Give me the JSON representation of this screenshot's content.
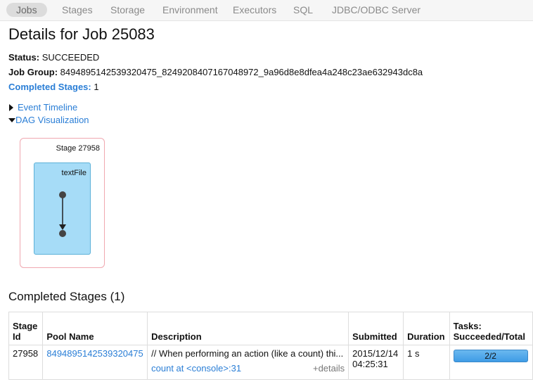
{
  "nav": {
    "items": [
      "Jobs",
      "Stages",
      "Storage",
      "Environment",
      "Executors",
      "SQL",
      "JDBC/ODBC Server"
    ],
    "active": "Jobs"
  },
  "page": {
    "title": "Details for Job 25083"
  },
  "info": {
    "status_label": "Status:",
    "status_value": "SUCCEEDED",
    "job_group_label": "Job Group:",
    "job_group_value": "8494895142539320475_8249208407167048972_9a96d8e8dfea4a248c23ae632943dc8a",
    "completed_stages_label": "Completed Stages:",
    "completed_stages_value": "1"
  },
  "toggles": {
    "event_timeline": "Event Timeline",
    "dag_visualization": "DAG Visualization"
  },
  "dag": {
    "stage_label": "Stage 27958",
    "rdd_label": "textFile"
  },
  "completed_section": {
    "title": "Completed Stages (1)",
    "headers": {
      "stage_id": "Stage Id",
      "pool_name": "Pool Name",
      "description": "Description",
      "submitted": "Submitted",
      "duration": "Duration",
      "tasks": "Tasks: Succeeded/Total"
    },
    "rows": [
      {
        "stage_id": "27958",
        "pool_name": "8494895142539320475",
        "description": "// When performing an action (like a count) thi...",
        "description_link": "count at <console>:31",
        "details": "+details",
        "submitted": "2015/12/14 04:25:31",
        "duration": "1 s",
        "tasks": "2/2",
        "tasks_fraction": 1.0
      }
    ]
  },
  "colors": {
    "link": "#2a7ed6",
    "stage_border": "#f0a8b0",
    "rdd_fill": "#a6dcf7",
    "progress_fill": "#3f9ce6"
  }
}
